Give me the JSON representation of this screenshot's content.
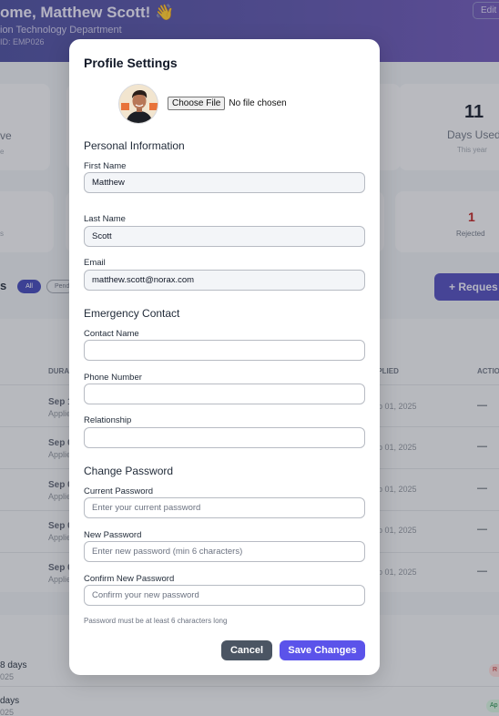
{
  "background": {
    "greeting": "ome, Matthew Scott! 👋",
    "department": "ion Technology Department",
    "employee_id": "ID: EMP026",
    "edit_label": "Edit",
    "stat_left_title": "ve",
    "stat_left_sub": "e",
    "stat_right_value": "11",
    "stat_right_title": "Days Used",
    "stat_right_sub": "This year",
    "stat2_left_sub": "s",
    "stat2_right_value": "1",
    "stat2_right_label": "Rejected",
    "section_suffix": "s",
    "filter_all": "All",
    "filter_pending": "Pend",
    "request_button": "+ Reques",
    "col_duration": "DURA",
    "col_applied": "PPLIED",
    "col_action": "ACTIO",
    "rows": [
      {
        "date": "Sep 1",
        "sub": "Applie",
        "applied": "ep 01, 2025",
        "action": "—"
      },
      {
        "date": "Sep 0",
        "sub": "Applie",
        "applied": "ep 01, 2025",
        "action": "—"
      },
      {
        "date": "Sep 0",
        "sub": "Applie",
        "applied": "ep 01, 2025",
        "action": "—"
      },
      {
        "date": "Sep 0",
        "sub": "Applie",
        "applied": "ep 01, 2025",
        "action": "—"
      },
      {
        "date": "Sep 0",
        "sub": "Applie",
        "applied": "ep 01, 2025",
        "action": "—"
      }
    ],
    "bottom_rows": [
      {
        "days": "8 days",
        "year": "025",
        "badge": "R"
      },
      {
        "days": "days",
        "year": "025",
        "badge": "Ap"
      }
    ]
  },
  "modal": {
    "title": "Profile Settings",
    "choose_file_label": "Choose File",
    "file_status": "No file chosen",
    "personal_section": "Personal Information",
    "first_name_label": "First Name",
    "first_name_value": "Matthew",
    "last_name_label": "Last Name",
    "last_name_value": "Scott",
    "email_label": "Email",
    "email_value": "matthew.scott@norax.com",
    "emergency_section": "Emergency Contact",
    "contact_name_label": "Contact Name",
    "contact_name_value": "",
    "phone_label": "Phone Number",
    "phone_value": "",
    "relationship_label": "Relationship",
    "relationship_value": "",
    "password_section": "Change Password",
    "current_password_label": "Current Password",
    "current_password_placeholder": "Enter your current password",
    "new_password_label": "New Password",
    "new_password_placeholder": "Enter new password (min 6 characters)",
    "confirm_password_label": "Confirm New Password",
    "confirm_password_placeholder": "Confirm your new password",
    "password_hint": "Password must be at least 6 characters long",
    "cancel_label": "Cancel",
    "save_label": "Save Changes"
  },
  "colors": {
    "primary": "#5b53ea",
    "cancel": "#4b5563",
    "header_start": "#46489a",
    "header_end": "#6a52b4",
    "rejected": "#b91c1c"
  },
  "icons": {
    "avatar": "profile-photo",
    "wave": "waving-hand"
  }
}
